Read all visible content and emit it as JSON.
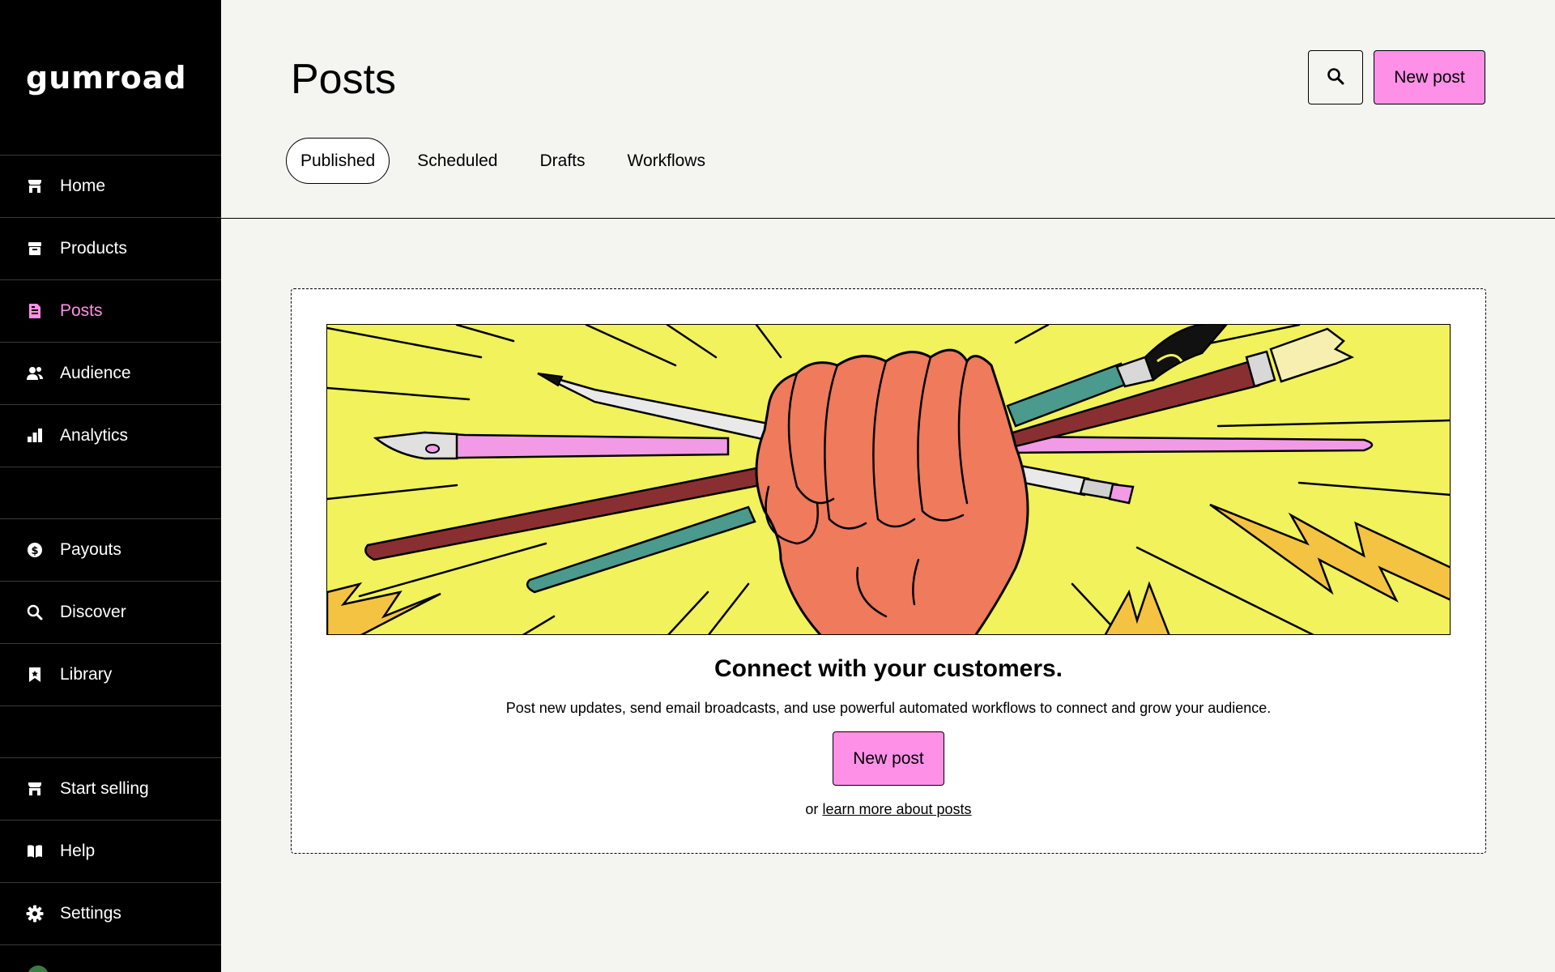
{
  "app": {
    "logo_text": "GUMROAD"
  },
  "sidebar": {
    "items": [
      {
        "label": "Home",
        "icon": "store-icon"
      },
      {
        "label": "Products",
        "icon": "archive-icon"
      },
      {
        "label": "Posts",
        "icon": "document-icon",
        "active": true
      },
      {
        "label": "Audience",
        "icon": "people-icon"
      },
      {
        "label": "Analytics",
        "icon": "bar-chart-icon"
      },
      {
        "label": "Payouts",
        "icon": "dollar-circle-icon"
      },
      {
        "label": "Discover",
        "icon": "search-icon"
      },
      {
        "label": "Library",
        "icon": "bookmark-icon"
      },
      {
        "label": "Start selling",
        "icon": "store-icon"
      },
      {
        "label": "Help",
        "icon": "book-icon"
      },
      {
        "label": "Settings",
        "icon": "gear-icon"
      }
    ]
  },
  "header": {
    "title": "Posts",
    "search_icon": "search-icon",
    "new_post_label": "New post",
    "tabs": [
      {
        "label": "Published",
        "active": true
      },
      {
        "label": "Scheduled"
      },
      {
        "label": "Drafts"
      },
      {
        "label": "Workflows"
      }
    ]
  },
  "empty_state": {
    "illustration": "fist-holding-pencils-and-brushes",
    "heading": "Connect with your customers.",
    "description": "Post new updates, send email broadcasts, and use powerful automated workflows to connect and grow your audience.",
    "button_label": "New post",
    "footer_prefix": "or",
    "footer_link": "learn more about posts"
  },
  "colors": {
    "accent_pink": "#ff90e8",
    "sidebar_bg": "#000000",
    "page_bg": "#f4f4f0",
    "illustration_yellow": "#f1f25c"
  }
}
